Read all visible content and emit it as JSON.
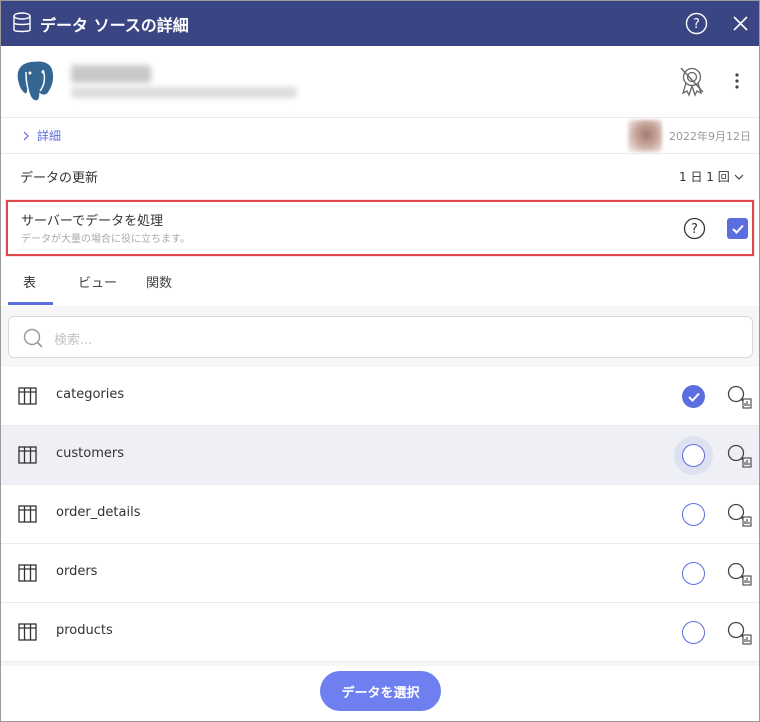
{
  "titlebar": {
    "title": "データ ソースの詳細"
  },
  "details": {
    "link_label": "詳細",
    "date": "2022年9月12日"
  },
  "refresh": {
    "label": "データの更新",
    "value": "1 日 1 回"
  },
  "server_processing": {
    "title": "サーバーでデータを処理",
    "subtitle": "データが大量の場合に役に立ちます。",
    "checked": true
  },
  "tabs": [
    {
      "label": "表",
      "active": true
    },
    {
      "label": "ビュー",
      "active": false
    },
    {
      "label": "関数",
      "active": false
    }
  ],
  "search": {
    "placeholder": "検索..."
  },
  "tables": [
    {
      "name": "categories",
      "selected": true
    },
    {
      "name": "customers",
      "selected": false,
      "hovered": true
    },
    {
      "name": "order_details",
      "selected": false
    },
    {
      "name": "orders",
      "selected": false
    },
    {
      "name": "products",
      "selected": false
    }
  ],
  "footer": {
    "select_button": "データを選択"
  },
  "colors": {
    "titlebar": "#3a4683",
    "accent": "#5b6ee0",
    "highlight_border": "#e0474c",
    "button": "#6e7ff0"
  },
  "icons": [
    "database-icon",
    "help-icon",
    "close-icon",
    "postgresql-logo",
    "certificate-off-icon",
    "kebab-menu-icon",
    "chevron-right-icon",
    "chevron-down-icon",
    "search-icon",
    "table-icon",
    "preview-icon"
  ]
}
